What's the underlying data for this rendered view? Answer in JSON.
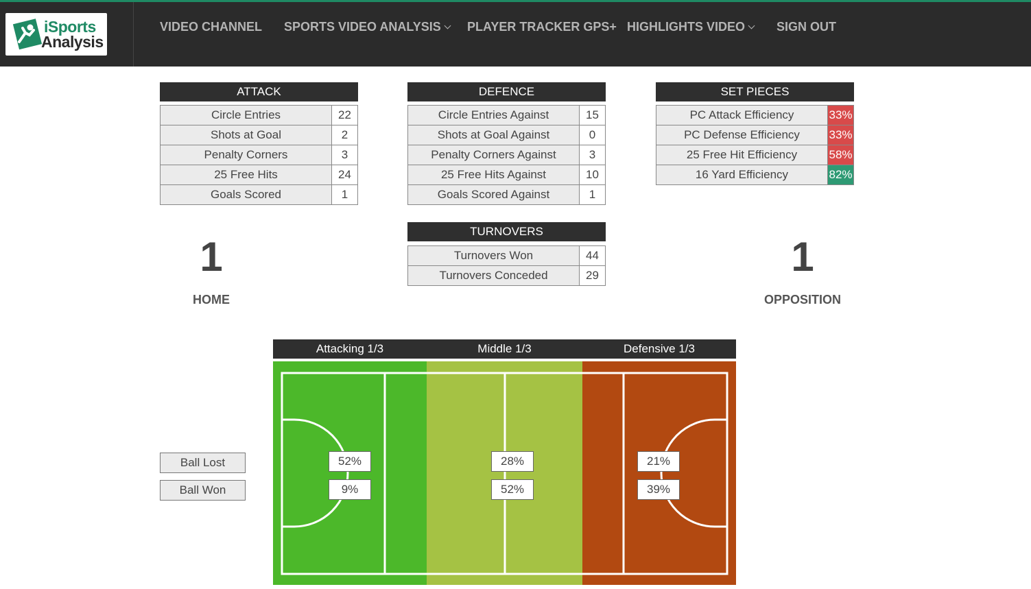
{
  "brand": {
    "line1": "iSports",
    "line2": "Analysis"
  },
  "nav": {
    "items": [
      {
        "label": "VIDEO CHANNEL"
      },
      {
        "label": "SPORTS VIDEO ANALYSIS"
      },
      {
        "label": "PLAYER TRACKER GPS+"
      },
      {
        "label": "HIGHLIGHTS VIDEO"
      },
      {
        "label": "SIGN OUT"
      }
    ]
  },
  "attack": {
    "title": "ATTACK",
    "rows": [
      {
        "label": "Circle Entries",
        "value": "22"
      },
      {
        "label": "Shots at Goal",
        "value": "2"
      },
      {
        "label": "Penalty Corners",
        "value": "3"
      },
      {
        "label": "25 Free Hits",
        "value": "24"
      },
      {
        "label": "Goals Scored",
        "value": "1"
      }
    ]
  },
  "defence": {
    "title": "DEFENCE",
    "rows": [
      {
        "label": "Circle Entries Against",
        "value": "15"
      },
      {
        "label": "Shots at Goal Against",
        "value": "0"
      },
      {
        "label": "Penalty Corners Against",
        "value": "3"
      },
      {
        "label": "25 Free Hits Against",
        "value": "10"
      },
      {
        "label": "Goals Scored Against",
        "value": "1"
      }
    ]
  },
  "set_pieces": {
    "title": "SET PIECES",
    "rows": [
      {
        "label": "PC Attack Efficiency",
        "value": "33%",
        "status_color": "#d84a4a"
      },
      {
        "label": "PC Defense Efficiency",
        "value": "33%",
        "status_color": "#d84a4a"
      },
      {
        "label": "25 Free Hit Efficiency",
        "value": "58%",
        "status_color": "#d84a4a"
      },
      {
        "label": "16 Yard Efficiency",
        "value": "82%",
        "status_color": "#2e9a74"
      }
    ]
  },
  "turnovers": {
    "title": "TURNOVERS",
    "rows": [
      {
        "label": "Turnovers Won",
        "value": "44"
      },
      {
        "label": "Turnovers Conceded",
        "value": "29"
      }
    ]
  },
  "score": {
    "home": {
      "goals": "1",
      "label": "HOME"
    },
    "opposition": {
      "goals": "1",
      "label": "OPPOSITION"
    }
  },
  "pitch": {
    "zones": [
      {
        "label": "Attacking 1/3",
        "color": "#4cb82a",
        "ball_lost": "52%",
        "ball_won": "9%"
      },
      {
        "label": "Middle 1/3",
        "color": "#a5c244",
        "ball_lost": "28%",
        "ball_won": "52%"
      },
      {
        "label": "Defensive 1/3",
        "color": "#b24911",
        "ball_lost": "21%",
        "ball_won": "39%"
      }
    ],
    "legend": {
      "lost": "Ball Lost",
      "won": "Ball Won"
    }
  }
}
